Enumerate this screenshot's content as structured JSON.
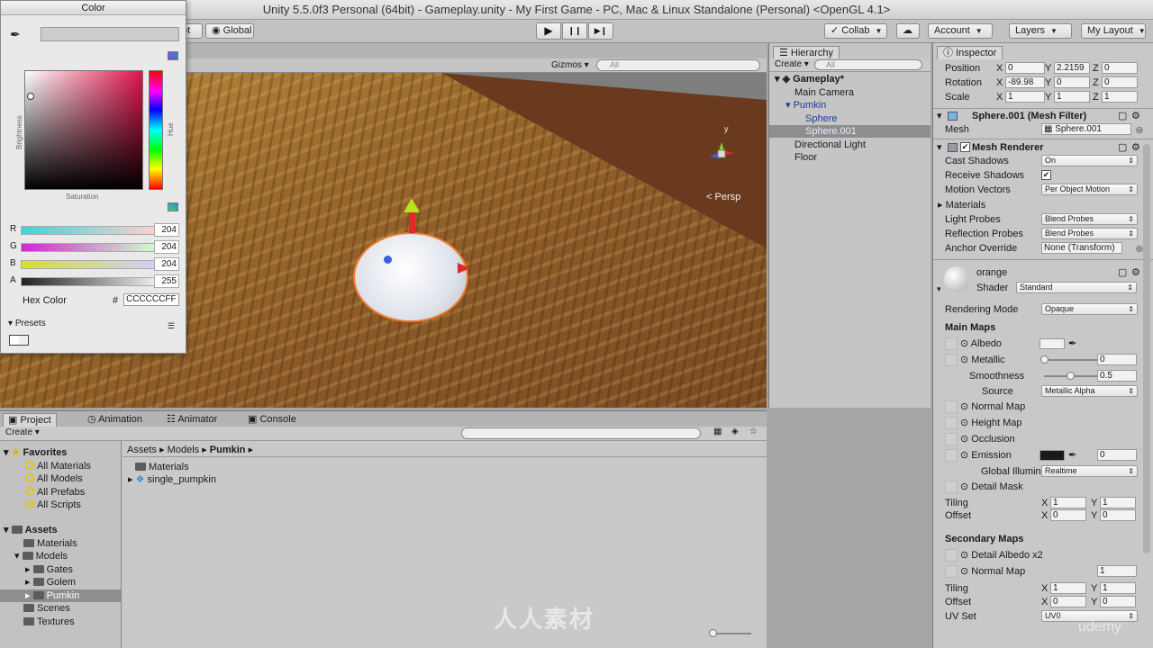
{
  "window": {
    "title": "Unity 5.5.0f3 Personal (64bit) - Gameplay.unity - My First Game - PC, Mac & Linux Standalone (Personal) <OpenGL 4.1>"
  },
  "toolbar": {
    "pivot_label": "ot",
    "global_label": "Global",
    "play_icon": "▶",
    "pause_icon": "❙❙",
    "step_icon": "▶❙",
    "collab_label": "Collab",
    "account_label": "Account",
    "layers_label": "Layers",
    "layout_label": "My Layout"
  },
  "color_picker": {
    "title": "Color",
    "brightness_label": "Brightness",
    "hue_label": "Hue",
    "saturation_label": "Saturation",
    "channels": [
      {
        "name": "R",
        "value": "204"
      },
      {
        "name": "G",
        "value": "204"
      },
      {
        "name": "B",
        "value": "204"
      },
      {
        "name": "A",
        "value": "255"
      }
    ],
    "hex_label": "Hex Color",
    "hex_hash": "#",
    "hex_value": "CCCCCCFF",
    "presets_label": "Presets"
  },
  "scene": {
    "gizmos_label": "Gizmos",
    "search_placeholder": "All",
    "persp_label": "Persp",
    "gizmo_y_label": "y"
  },
  "hierarchy": {
    "tab_label": "Hierarchy",
    "create_label": "Create",
    "search_placeholder": "All",
    "scene_name": "Gameplay*",
    "items": [
      {
        "label": "Main Camera"
      },
      {
        "label": "Pumkin"
      },
      {
        "label": "Sphere"
      },
      {
        "label": "Sphere.001"
      },
      {
        "label": "Directional Light"
      },
      {
        "label": "Floor"
      }
    ]
  },
  "inspector": {
    "tab_label": "Inspector",
    "transform": {
      "position_label": "Position",
      "position": [
        "0",
        "2.2159",
        "0"
      ],
      "rotation_label": "Rotation",
      "rotation": [
        "-89.98",
        "0",
        "0"
      ],
      "scale_label": "Scale",
      "scale": [
        "1",
        "1",
        "1"
      ],
      "axes": [
        "X",
        "Y",
        "Z"
      ]
    },
    "mesh_filter": {
      "title": "Sphere.001 (Mesh Filter)",
      "mesh_label": "Mesh",
      "mesh_value": "Sphere.001"
    },
    "mesh_renderer": {
      "title": "Mesh Renderer",
      "cast_shadows_label": "Cast Shadows",
      "cast_shadows_value": "On",
      "receive_shadows_label": "Receive Shadows",
      "receive_shadows_check": "✔",
      "motion_vectors_label": "Motion Vectors",
      "motion_vectors_value": "Per Object Motion",
      "materials_label": "Materials",
      "light_probes_label": "Light Probes",
      "light_probes_value": "Blend Probes",
      "reflection_probes_label": "Reflection Probes",
      "reflection_probes_value": "Blend Probes",
      "anchor_override_label": "Anchor Override",
      "anchor_override_value": "None (Transform)"
    },
    "material": {
      "name": "orange",
      "shader_label": "Shader",
      "shader_value": "Standard",
      "rendering_mode_label": "Rendering Mode",
      "rendering_mode_value": "Opaque",
      "main_maps_label": "Main Maps",
      "albedo_label": "Albedo",
      "metallic_label": "Metallic",
      "metallic_value": "0",
      "smoothness_label": "Smoothness",
      "smoothness_value": "0.5",
      "source_label": "Source",
      "source_value": "Metallic Alpha",
      "normal_map_label": "Normal Map",
      "height_map_label": "Height Map",
      "occlusion_label": "Occlusion",
      "emission_label": "Emission",
      "emission_value": "0",
      "global_illum_label": "Global Illumin",
      "global_illum_value": "Realtime",
      "detail_mask_label": "Detail Mask",
      "tiling_label": "Tiling",
      "tiling": [
        "1",
        "1"
      ],
      "offset_label": "Offset",
      "offset": [
        "0",
        "0"
      ],
      "secondary_maps_label": "Secondary Maps",
      "detail_albedo_label": "Detail Albedo x2",
      "normal_map2_label": "Normal Map",
      "normal_map2_value": "1",
      "tiling2": [
        "1",
        "1"
      ],
      "offset2": [
        "0",
        "0"
      ],
      "uv_set_label": "UV Set",
      "uv_set_value": "UV0",
      "xy": [
        "X",
        "Y"
      ]
    }
  },
  "project": {
    "tabs": [
      {
        "label": "Project"
      },
      {
        "label": "Animation"
      },
      {
        "label": "Animator"
      },
      {
        "label": "Console"
      }
    ],
    "create_label": "Create",
    "favorites_label": "Favorites",
    "favorites": [
      {
        "label": "All Materials"
      },
      {
        "label": "All Models"
      },
      {
        "label": "All Prefabs"
      },
      {
        "label": "All Scripts"
      }
    ],
    "assets_label": "Assets",
    "assets_tree": [
      {
        "label": "Materials"
      },
      {
        "label": "Models"
      },
      {
        "label": "Gates"
      },
      {
        "label": "Golem"
      },
      {
        "label": "Pumkin"
      },
      {
        "label": "Scenes"
      },
      {
        "label": "Textures"
      }
    ],
    "breadcrumb": [
      "Assets",
      "Models",
      "Pumkin"
    ],
    "breadcrumb_sep": "▸",
    "files": [
      {
        "label": "Materials"
      },
      {
        "label": "single_pumpkin"
      }
    ]
  },
  "overlays": {
    "watermark_text": "人人素材",
    "udemy_text": "udemy"
  },
  "colors": {
    "selection": "#8e8e8e",
    "accent_orange": "#f07a2c",
    "current_color": "#CCCCCC"
  }
}
